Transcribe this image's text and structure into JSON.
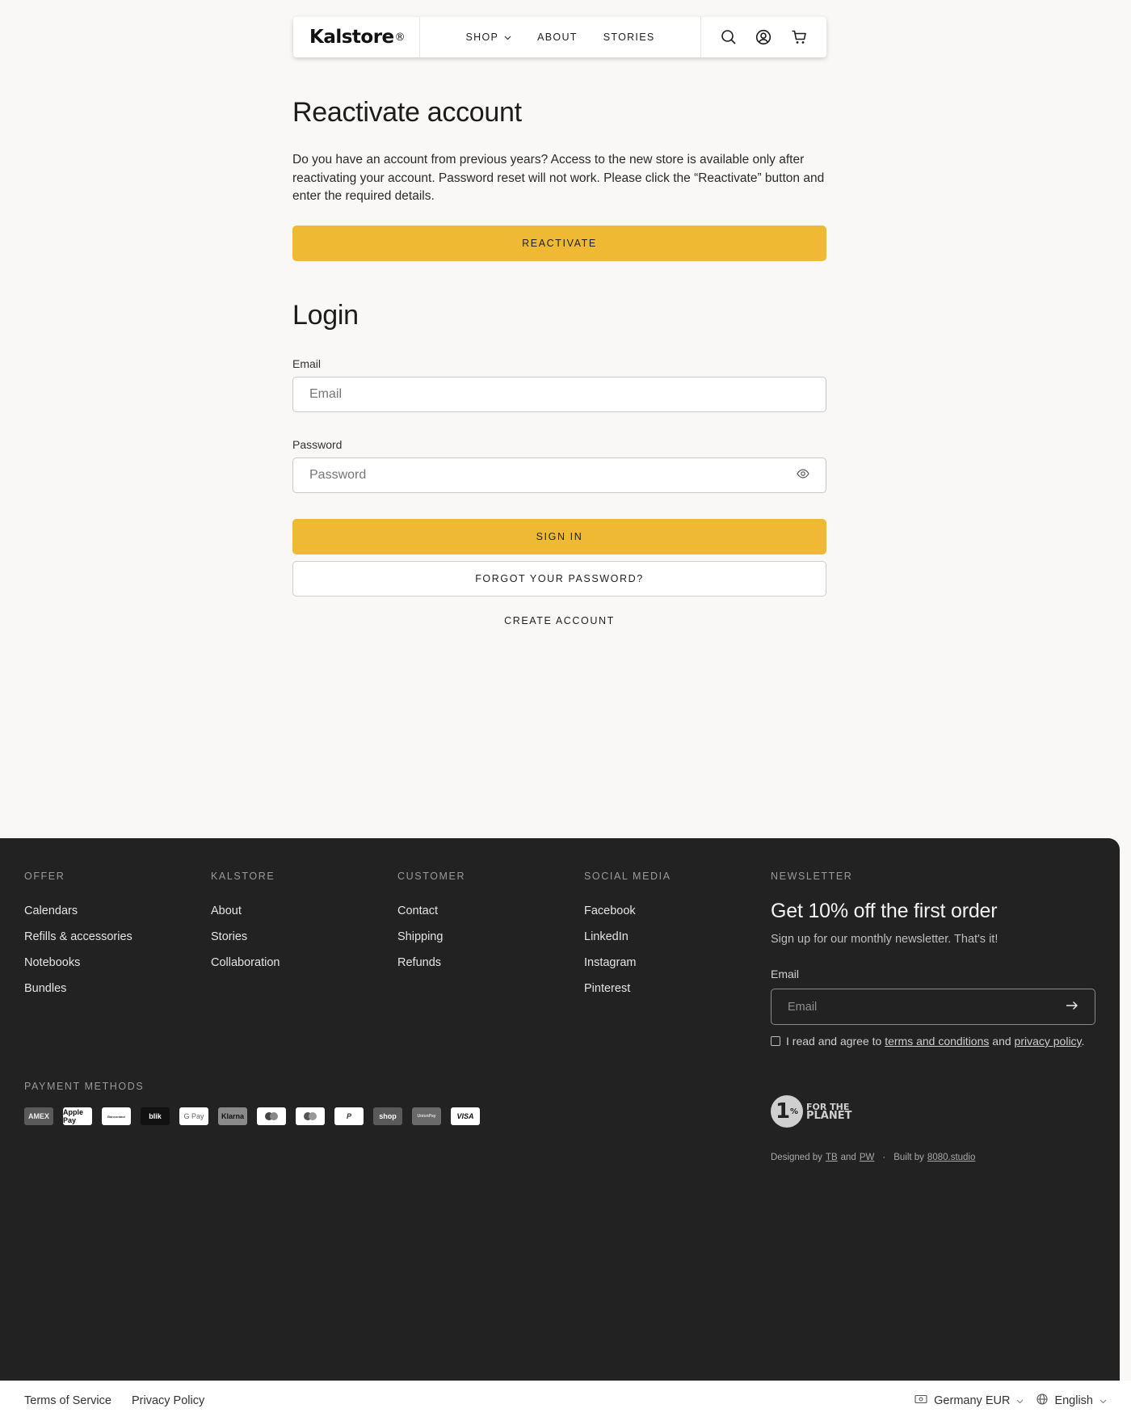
{
  "header": {
    "logo": "Kalstore",
    "logo_mark": "®",
    "nav": [
      {
        "label": "SHOP",
        "has_dropdown": true
      },
      {
        "label": "ABOUT"
      },
      {
        "label": "STORIES"
      }
    ],
    "icons": [
      "search-icon",
      "account-icon",
      "cart-icon"
    ]
  },
  "reactivate": {
    "title": "Reactivate account",
    "description": "Do you have an account from previous years? Access to the new store is available only after reactivating your account. Password reset will not work. Please click the “Reactivate” button and enter the required details.",
    "button": "REACTIVATE"
  },
  "login": {
    "title": "Login",
    "email_label": "Email",
    "email_placeholder": "Email",
    "password_label": "Password",
    "password_placeholder": "Password",
    "sign_in": "SIGN IN",
    "forgot": "FORGOT YOUR PASSWORD?",
    "create": "CREATE ACCOUNT"
  },
  "footer": {
    "columns": [
      {
        "heading": "OFFER",
        "items": [
          "Calendars",
          "Refills & accessories",
          "Notebooks",
          "Bundles"
        ]
      },
      {
        "heading": "KALSTORE",
        "items": [
          "About",
          "Stories",
          "Collaboration"
        ]
      },
      {
        "heading": "CUSTOMER",
        "items": [
          "Contact",
          "Shipping",
          "Refunds"
        ]
      },
      {
        "heading": "SOCIAL MEDIA",
        "items": [
          "Facebook",
          "LinkedIn",
          "Instagram",
          "Pinterest"
        ]
      }
    ],
    "newsletter": {
      "heading": "NEWSLETTER",
      "title": "Get 10% off the first order",
      "subtitle": "Sign up for our monthly newsletter. That's it!",
      "email_label": "Email",
      "email_placeholder": "Email",
      "consent_prefix": "I read and agree to",
      "consent_terms": "terms and conditions",
      "consent_and": "and",
      "consent_privacy": "privacy policy",
      "consent_suffix": "."
    },
    "payment_heading": "PAYMENT METHODS",
    "payment_methods": [
      "AMEX",
      "Apple Pay",
      "Bancontact",
      "blik",
      "G Pay",
      "Klarna",
      "Maestro",
      "Mastercard",
      "PayPal",
      "shop",
      "UnionPay",
      "VISA"
    ],
    "badge": {
      "number": "1",
      "percent": "%",
      "line1": "FOR THE",
      "line2": "PLANET"
    },
    "credits": {
      "designed_by": "Designed by",
      "designer1": "TB",
      "and": "and",
      "designer2": "PW",
      "dot": "·",
      "built_by": "Built by",
      "builder": "8080.studio"
    }
  },
  "bottom": {
    "links": [
      "Terms of Service",
      "Privacy Policy"
    ],
    "currency": "Germany EUR",
    "language": "English"
  },
  "colors": {
    "accent": "#f0b933",
    "footer_bg": "#222222",
    "page_bg": "#f9f8f6"
  }
}
